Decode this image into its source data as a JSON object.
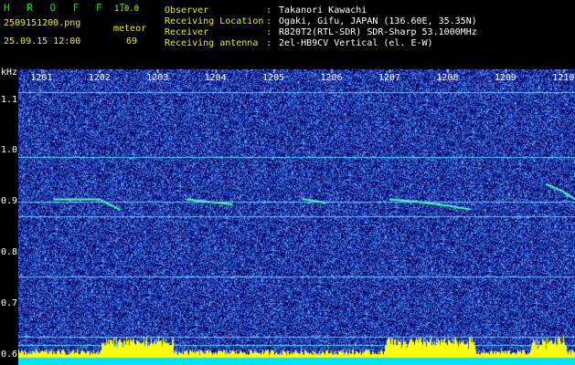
{
  "header": {
    "logo": "H R O F F T",
    "version": "1.0.0",
    "filename": "2509151200.png",
    "datetime": "25.09.15 12:00",
    "event_label": "meteor",
    "event_count": "69",
    "observer_key": "Observer",
    "observer_value": "Takanori Kawachi",
    "location_key": "Receiving Location",
    "location_value": "Ogaki, Gifu, JAPAN (136.60E, 35.35N)",
    "receiver_key": "Receiver",
    "receiver_value": "R820T2(RTL-SDR) SDR-Sharp 53.1000MHz",
    "antenna_key": "Receiving antenna",
    "antenna_value": "2el-HB9CV Vertical (el. E-W)",
    "colon": ":"
  },
  "chart_data": {
    "type": "heatmap",
    "ylabel": "kHz",
    "x_ticks": [
      "1201",
      "1202",
      "1203",
      "1204",
      "1205",
      "1206",
      "1207",
      "1208",
      "1209",
      "1210"
    ],
    "y_ticks": [
      "1.1",
      "1.0",
      "0.9",
      "0.8",
      "0.7",
      "0.6"
    ],
    "ylim": [
      0.58,
      1.16
    ],
    "xlim": [
      1200.6,
      1210.2
    ],
    "horizontal_lines_khz": [
      1.115,
      0.988,
      0.9,
      0.872,
      0.753,
      0.636,
      0.62
    ],
    "meteor_segments": [
      {
        "x": [
          1201.2,
          1202.0,
          1202.35
        ],
        "y": [
          0.905,
          0.905,
          0.885
        ]
      },
      {
        "x": [
          1203.5,
          1204.3
        ],
        "y": [
          0.905,
          0.895
        ]
      },
      {
        "x": [
          1205.5,
          1205.9
        ],
        "y": [
          0.906,
          0.898
        ]
      },
      {
        "x": [
          1207.0,
          1207.5,
          1208.0,
          1208.4
        ],
        "y": [
          0.905,
          0.9,
          0.893,
          0.885
        ]
      },
      {
        "x": [
          1209.7,
          1210.0,
          1210.2
        ],
        "y": [
          0.935,
          0.92,
          0.905
        ]
      }
    ],
    "colors": {
      "background": "#0a0a6e",
      "noise_light": "#2f6fe0",
      "line": "#4ad8ff",
      "meteor": "#4affb0",
      "activity": "#ffff00",
      "floor": "#00e5ff"
    }
  }
}
